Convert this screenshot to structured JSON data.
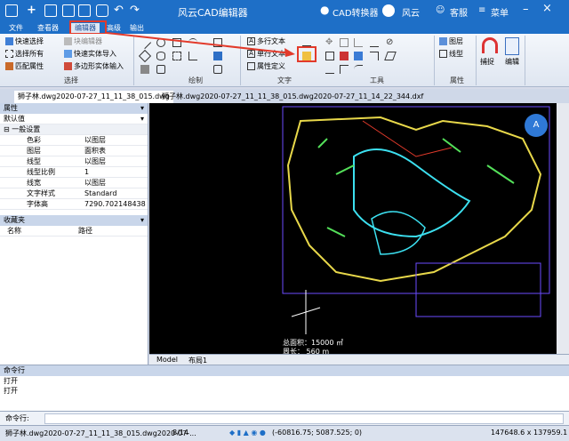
{
  "app": {
    "title": "风云CAD编辑器",
    "cad_converter": "CAD转换器",
    "fengyun": "风云",
    "service": "客服",
    "menu": "菜单"
  },
  "tabs": [
    "文件",
    "查看器",
    "编辑器",
    "高级",
    "输出"
  ],
  "ribbon": {
    "select": {
      "label": "选择",
      "items": [
        "快速选择",
        "选择所有",
        "匹配属性",
        "块编辑器",
        "快速实体导入",
        "多边形实体输入"
      ]
    },
    "draw_label": "绘制",
    "text": {
      "label": "文字",
      "items": [
        "多行文本",
        "单行文本",
        "属性定义"
      ]
    },
    "tools_label": "工具",
    "attr": {
      "label": "属性",
      "items": [
        "图层",
        "线型"
      ]
    },
    "snap_label": "捕捉",
    "edit_label": "编辑"
  },
  "doc_tabs": [
    "狮子林.dwg2020-07-27_11_11_38_015.dwg",
    "狮子林.dwg2020-07-27_11_11_38_015.dwg2020-07-27_11_14_22_344.dxf"
  ],
  "panel": {
    "title": "属性",
    "dropdown": "默认值",
    "group": "一般设置",
    "rows": [
      {
        "k": "色彩",
        "v": "以图层"
      },
      {
        "k": "图层",
        "v": "面积表"
      },
      {
        "k": "线型",
        "v": "以图层"
      },
      {
        "k": "线型比例",
        "v": "1"
      },
      {
        "k": "线宽",
        "v": "以图层"
      },
      {
        "k": "文字样式",
        "v": "Standard"
      },
      {
        "k": "字体高",
        "v": "7290.702148438"
      }
    ],
    "fav_title": "收藏夹",
    "fav_cols": [
      "名称",
      "路径"
    ]
  },
  "canvas": {
    "area_text": "总面积：15000 ㎡",
    "perimeter_text": "周长：  560 m"
  },
  "layout_tabs": [
    "Model",
    "布局1"
  ],
  "command": {
    "title": "命令行",
    "lines": [
      "打开",
      "打开"
    ],
    "input_label": "命令行:"
  },
  "status": {
    "file": "狮子林.dwg2020-07-27_11_11_38_015.dwg2020-07-...",
    "page": "8/14",
    "coords": "(-60816.75; 5087.525; 0)",
    "size": "147648.6 x 137959.1 x 0"
  },
  "colors": {
    "titlebar": "#1e6fc7",
    "highlight": "#e23a2b",
    "canvas_bg": "#000000"
  }
}
